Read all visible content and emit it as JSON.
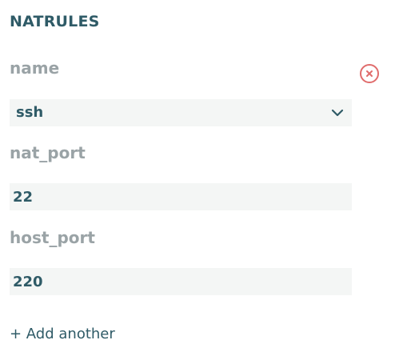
{
  "section": {
    "title": "NATRULES"
  },
  "fields": {
    "name": {
      "label": "name",
      "value": "ssh"
    },
    "nat_port": {
      "label": "nat_port",
      "value": "22"
    },
    "host_port": {
      "label": "host_port",
      "value": "220"
    }
  },
  "icons": {
    "remove": "close-circle-icon",
    "dropdown": "chevron-down-icon"
  },
  "actions": {
    "add_another": "+ Add another"
  },
  "colors": {
    "title": "#2f5b67",
    "label": "#9aa3a6",
    "value": "#2f5b67",
    "field_bg": "#f4f6f5",
    "remove": "#e06c6c"
  }
}
